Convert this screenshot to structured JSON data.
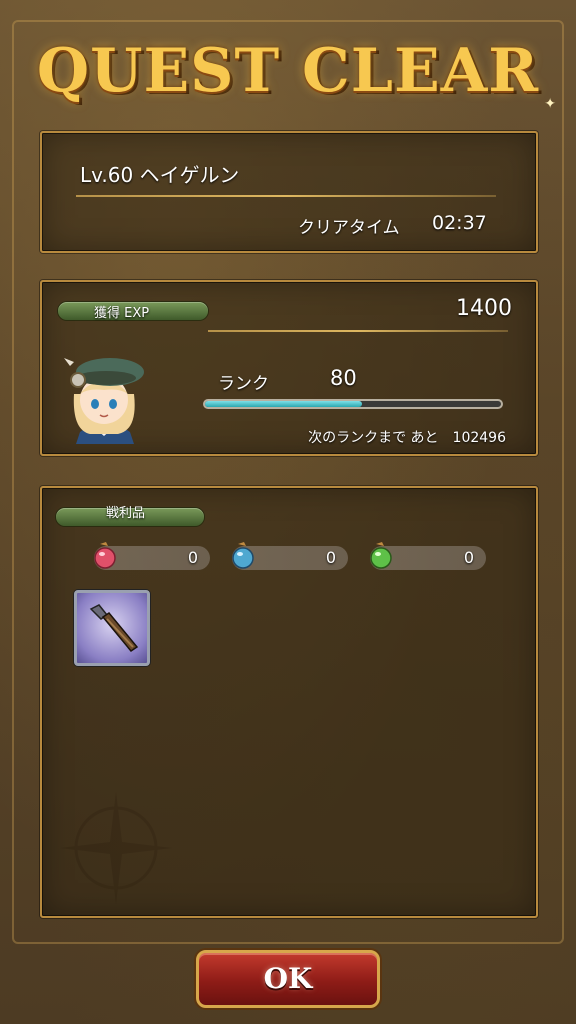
{
  "header": {
    "title": "QUEST CLEAR"
  },
  "quest": {
    "name": "Lv.60 ヘイゲルン",
    "clear_time_label": "クリアタイム",
    "clear_time_value": "02:37"
  },
  "exp": {
    "label": "獲得 EXP",
    "value": "1400",
    "rank_label": "ランク",
    "rank_value": "80",
    "rank_progress_fraction": 0.53,
    "next_rank_text": "次のランクまで あと　102496"
  },
  "loot": {
    "label": "戦利品",
    "gems": [
      {
        "icon": "red-gem-icon",
        "color": "#e0506a",
        "count": "0"
      },
      {
        "icon": "blue-gem-icon",
        "color": "#4fa8d0",
        "count": "0"
      },
      {
        "icon": "green-gem-icon",
        "color": "#5ec048",
        "count": "0"
      }
    ],
    "items": [
      {
        "icon": "dagger-icon"
      }
    ]
  },
  "actions": {
    "ok_label": "OK"
  },
  "colors": {
    "title_gold": "#f7c850",
    "frame_gold": "#b88a3e",
    "ok_red": "#c33a2d",
    "exp_bar": "#2aa8b0"
  }
}
